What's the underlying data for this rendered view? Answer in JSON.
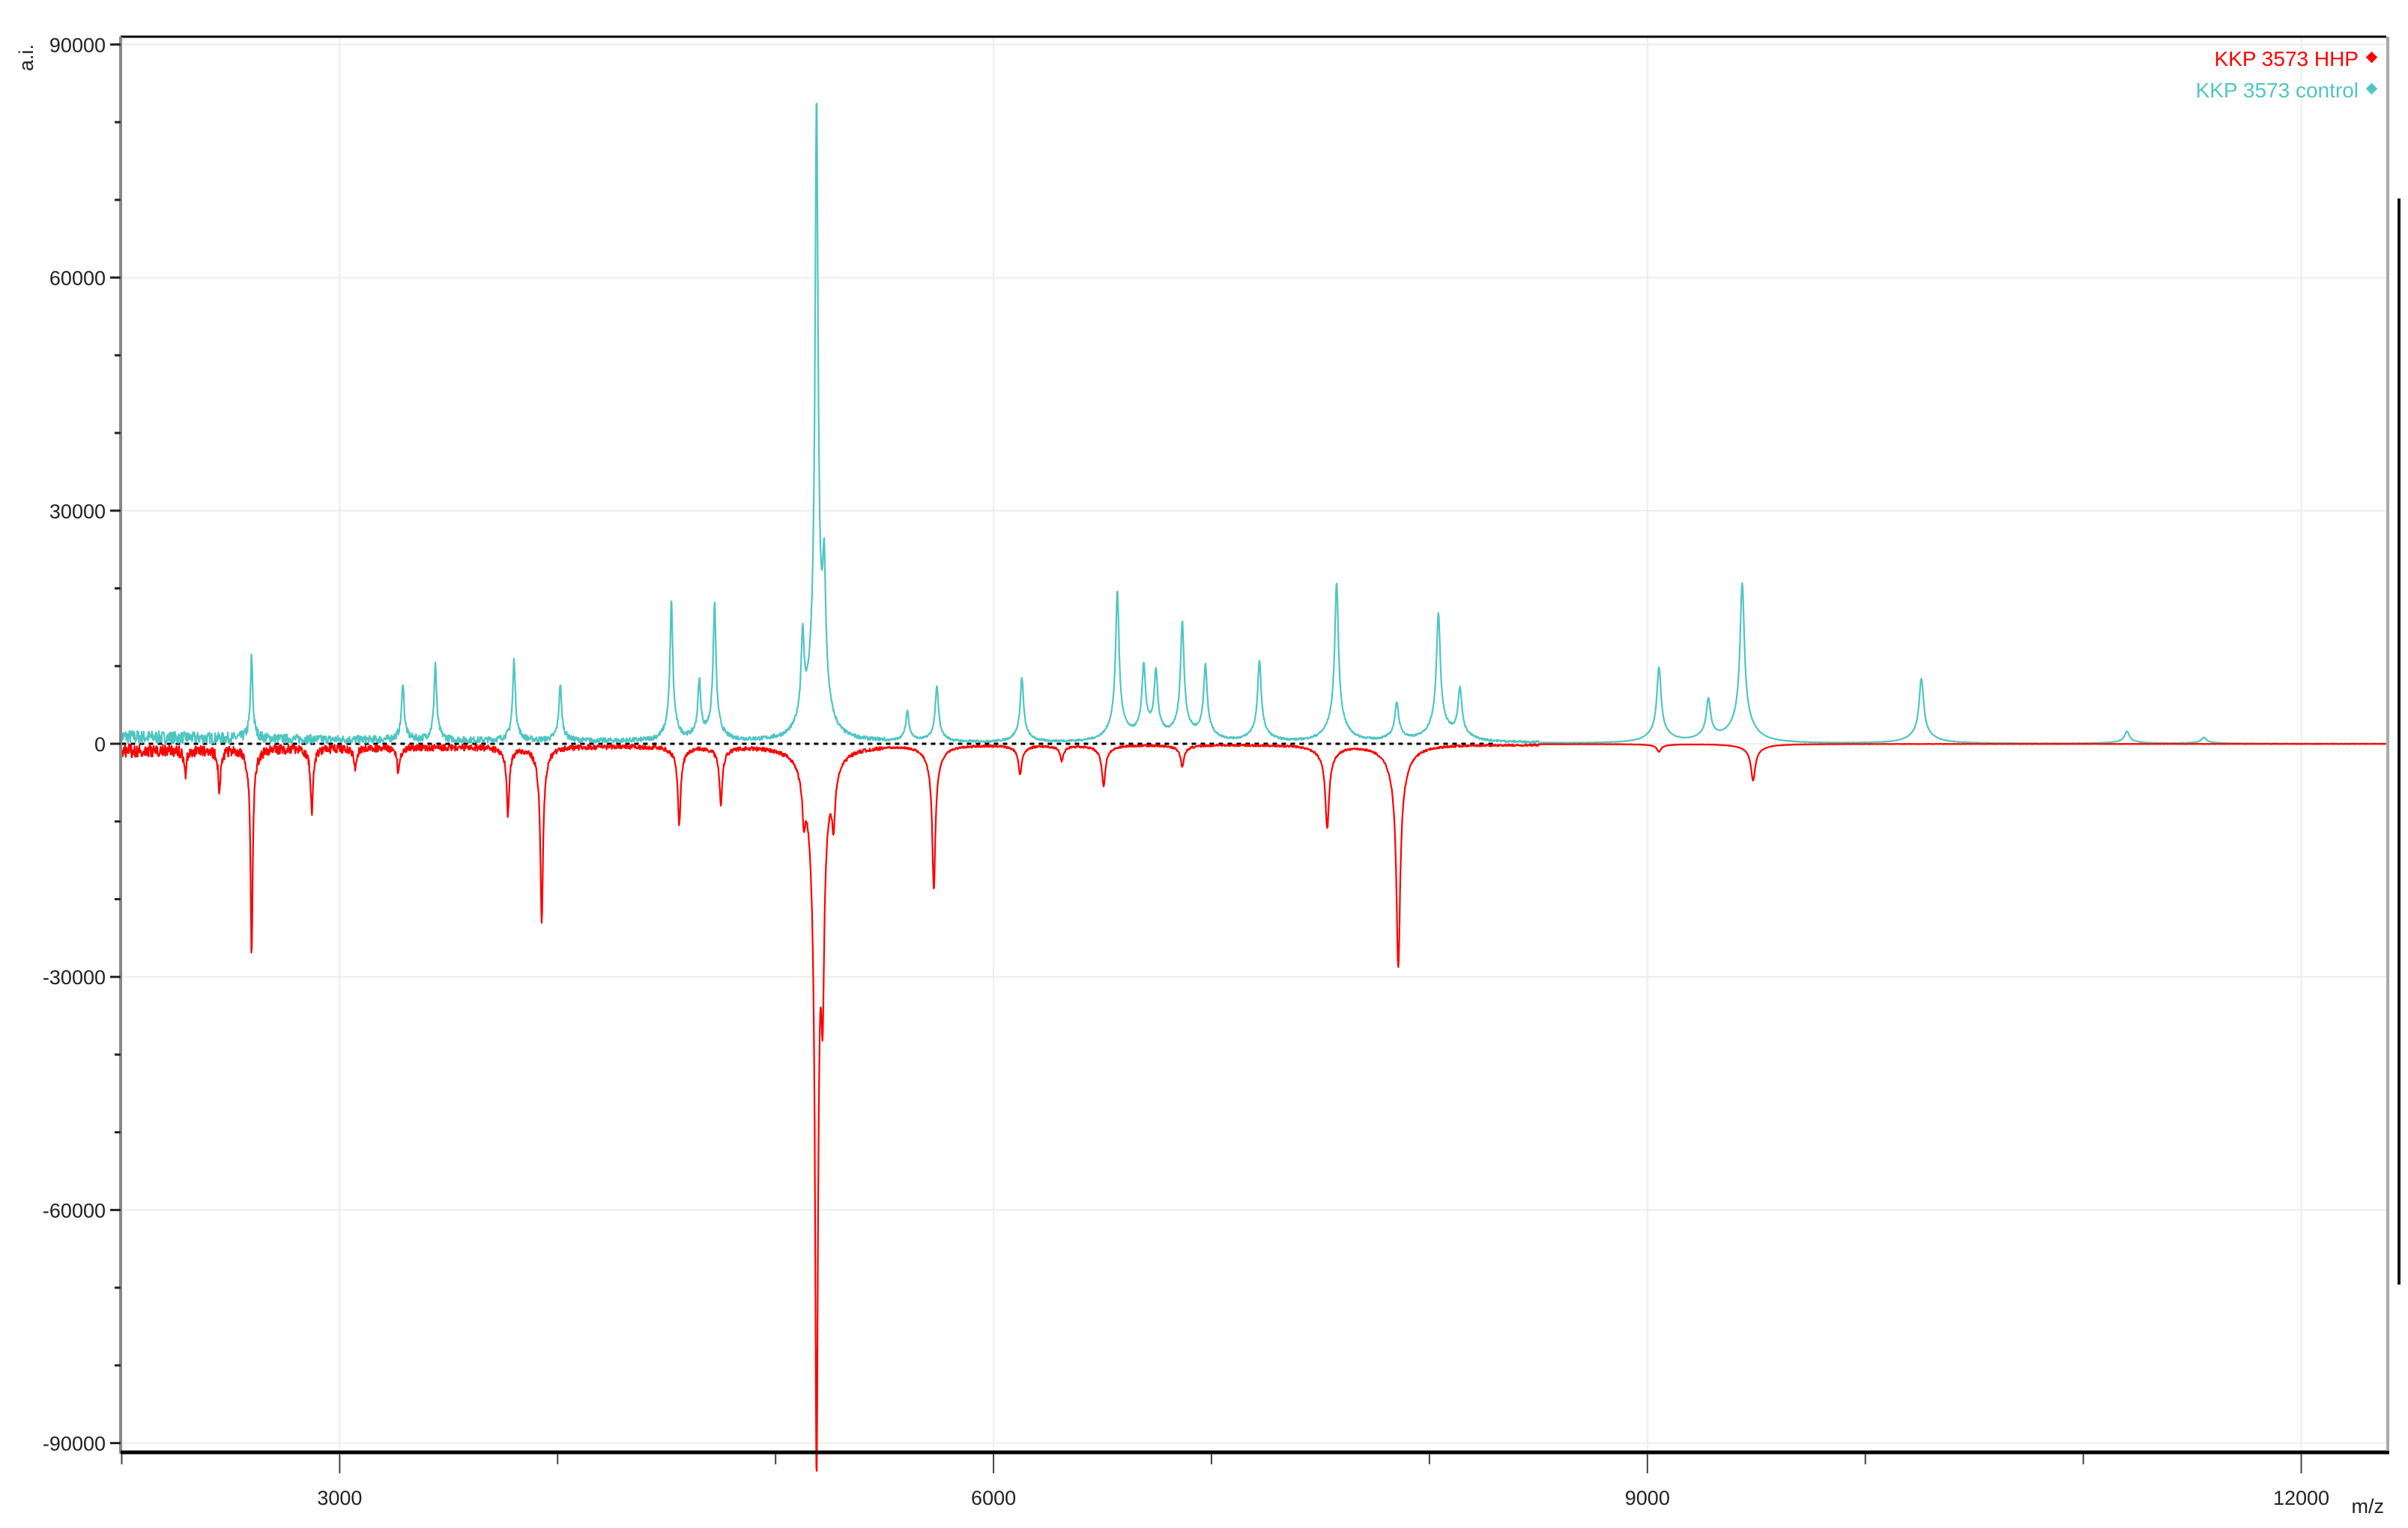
{
  "chart_data": {
    "type": "line",
    "title": "",
    "xlabel": "m/z",
    "ylabel": "a.i.",
    "xlim": [
      1995,
      12390
    ],
    "ylim": [
      -91000,
      91000
    ],
    "xticks": [
      3000,
      6000,
      9000,
      12000
    ],
    "xticks_minor_step": 1000,
    "yticks": [
      90000,
      60000,
      30000,
      0,
      -30000,
      -60000,
      -90000
    ],
    "yticks_minor_step": 10000,
    "xtick_labels": [
      "3000",
      "6000",
      "9000",
      "12000"
    ],
    "ytick_labels": [
      "90000",
      "60000",
      "30000",
      "0",
      "-30000",
      "-60000",
      "-90000"
    ],
    "grid": true,
    "legend_position": "top-right",
    "baseline_dashed_range": [
      2000,
      8300
    ],
    "series": [
      {
        "name": "KKP 3573 HHP",
        "color": "#ff0000",
        "direction": "down",
        "peaks": [
          [
            2292,
            3400
          ],
          [
            2448,
            5800
          ],
          [
            2596,
            27200
          ],
          [
            2872,
            8700
          ],
          [
            3071,
            2800
          ],
          [
            3269,
            3400
          ],
          [
            3772,
            8900
          ],
          [
            3927,
            23400
          ],
          [
            4558,
            10300
          ],
          [
            4749,
            7500
          ],
          [
            5130,
            6000
          ],
          [
            5188,
            92000
          ],
          [
            5216,
            24200
          ],
          [
            5266,
            7300
          ],
          [
            5726,
            18900
          ],
          [
            6122,
            3800
          ],
          [
            6313,
            2000
          ],
          [
            6505,
            5400
          ],
          [
            6866,
            2800
          ],
          [
            7531,
            10900
          ],
          [
            7857,
            29200
          ],
          [
            9053,
            1000
          ],
          [
            9485,
            4800
          ]
        ]
      },
      {
        "name": "KKP 3573 control",
        "color": "#4fc6c2",
        "direction": "up",
        "peaks": [
          [
            2596,
            10900
          ],
          [
            3290,
            7700
          ],
          [
            3439,
            10100
          ],
          [
            3800,
            10700
          ],
          [
            4012,
            7500
          ],
          [
            4522,
            18300
          ],
          [
            4650,
            7500
          ],
          [
            4720,
            17900
          ],
          [
            5124,
            11500
          ],
          [
            5188,
            82600
          ],
          [
            5223,
            17300
          ],
          [
            5605,
            4000
          ],
          [
            5740,
            7300
          ],
          [
            6130,
            8500
          ],
          [
            6568,
            19700
          ],
          [
            6689,
            9300
          ],
          [
            6745,
            8500
          ],
          [
            6866,
            15300
          ],
          [
            6972,
            9700
          ],
          [
            7220,
            10500
          ],
          [
            7574,
            20900
          ],
          [
            7850,
            5000
          ],
          [
            8041,
            16700
          ],
          [
            8140,
            6600
          ],
          [
            9053,
            9900
          ],
          [
            9280,
            5400
          ],
          [
            9435,
            20900
          ],
          [
            10257,
            8500
          ],
          [
            11200,
            1600
          ],
          [
            11553,
            800
          ]
        ]
      }
    ]
  }
}
